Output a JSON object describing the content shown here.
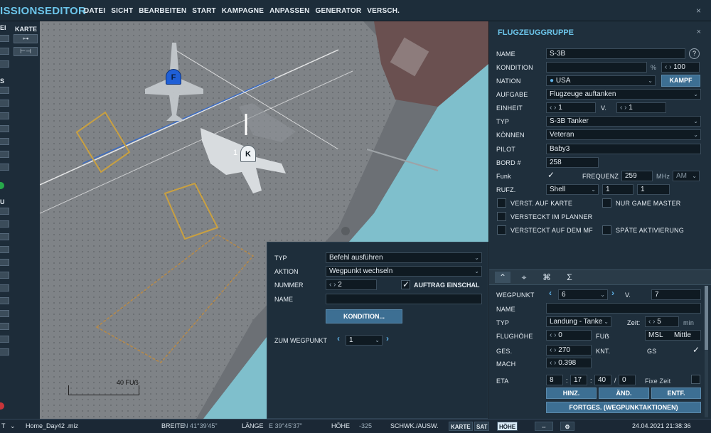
{
  "menubar": {
    "title": "ISSIONSEDITOR",
    "items": [
      "DATEI",
      "SICHT",
      "BEARBEITEN",
      "START",
      "KAMPAGNE",
      "ANPASSEN",
      "GENERATOR",
      "VERSCH."
    ],
    "close_glyph": "×"
  },
  "toolbar": {
    "label_left": "EI",
    "label_karte": "KARTE",
    "label_s": "S",
    "label_u": "U"
  },
  "map": {
    "scale_label": "40 FUẞ",
    "aircraft": [
      {
        "id": "F",
        "label": "F",
        "color": "#1f5fd6"
      },
      {
        "id": "K",
        "label": "K",
        "color": "#e9eef2",
        "index_label": "1"
      }
    ]
  },
  "action_panel": {
    "typ_label": "TYP",
    "typ_value": "Befehl ausführen",
    "aktion_label": "AKTION",
    "aktion_value": "Wegpunkt wechseln",
    "nummer_label": "NUMMER",
    "nummer_value": "2",
    "auftrag_label": "AUFTRAG EINSCHAL",
    "auftrag_checked": true,
    "name_label": "NAME",
    "name_value": "",
    "kondition_button": "KONDITION...",
    "zum_wegpunkt_label": "ZUM WEGPUNKT",
    "zum_wegpunkt_value": "1"
  },
  "group_panel": {
    "title": "FLUGZEUGGRUPPE",
    "close_glyph": "×",
    "name_label": "NAME",
    "name_value": "S-3B",
    "help_glyph": "?",
    "kondition_label": "KONDITION",
    "kondition_percent": "%",
    "kondition_value": "100",
    "nation_label": "NATION",
    "nation_value": "USA",
    "kampf_button": "KAMPF",
    "aufgabe_label": "AUFGABE",
    "aufgabe_value": "Flugzeuge auftanken",
    "einheit_label": "EINHEIT",
    "einheit_value": "1",
    "einheit_v_label": "V.",
    "einheit_v_value": "1",
    "typ_label": "TYP",
    "typ_value": "S-3B Tanker",
    "koennen_label": "KÖNNEN",
    "koennen_value": "Veteran",
    "pilot_label": "PILOT",
    "pilot_value": "Baby3",
    "bord_label": "BORD #",
    "bord_value": "258",
    "funk_label": "Funk",
    "funk_checked": true,
    "frequenz_label": "FREQUENZ",
    "frequenz_value": "259",
    "mhz_label": "MHz",
    "modulation_value": "AM",
    "rufz_label": "RUFZ.",
    "rufz_value": "Shell",
    "rufz_num1": "1",
    "rufz_num2": "1",
    "checks": [
      {
        "label": "VERST. AUF KARTE",
        "checked": false
      },
      {
        "label": "NUR GAME MASTER",
        "checked": false
      },
      {
        "label": "VERSTECKT IM PLANNER",
        "checked": false
      },
      {
        "label": "VERSTECKT AUF DEM MF",
        "checked": false
      },
      {
        "label": "SPÄTE AKTIVIERUNG",
        "checked": false
      }
    ]
  },
  "waypoint_panel": {
    "tabs": [
      "route-icon",
      "target-icon",
      "payload-icon",
      "sigma-icon"
    ],
    "tab_glyphs": [
      "⌃",
      "⌖",
      "⌘",
      "Σ"
    ],
    "wegpunkt_label": "WEGPUNKT",
    "wegpunkt_value": "6",
    "v_label": "V.",
    "v_value": "7",
    "name_label": "NAME",
    "name_value": "",
    "typ_label": "TYP",
    "typ_value": "Landung - Tanke",
    "zeit_label": "Zeit:",
    "zeit_value": "5",
    "min_label": "min",
    "flughoehe_label": "FLUGHÖHE",
    "flughoehe_value": "0",
    "fuss_label": "FUẞ",
    "alt_ref_value": "MSL",
    "alt_ref_extra": "Mittle",
    "ges_label": "GES.",
    "ges_value": "270",
    "knt_label": "KNT.",
    "gs_label": "GS",
    "gs_checked": true,
    "mach_label": "MACH",
    "mach_value": "0.398",
    "eta_label": "ETA",
    "eta_h": "8",
    "eta_m": "17",
    "eta_s": "40",
    "eta_d": "0",
    "fixe_zeit_label": "Fixe Zeit",
    "hinz_button": "HINZ.",
    "aend_button": "ÄND.",
    "entf_button": "ENTF.",
    "fortges_button": "FORTGES. (WEGPUNKTAKTIONEN)"
  },
  "statusbar": {
    "left_label": "T",
    "file": "Home_Day42 .miz",
    "breite_label": "BREITE",
    "breite_value": "N 41°39'45\"",
    "laenge_label": "LÄNGE",
    "laenge_value": "E 39°45'37\"",
    "hoehe_label": "HÖHE",
    "hoehe_value": "-325",
    "schwk_label": "SCHWK./AUSW.",
    "karte_btn": "KARTE",
    "sat_btn": "SAT",
    "hoehe_btn": "HÖHE",
    "datetime": "24.04.2021 21:38:36"
  }
}
